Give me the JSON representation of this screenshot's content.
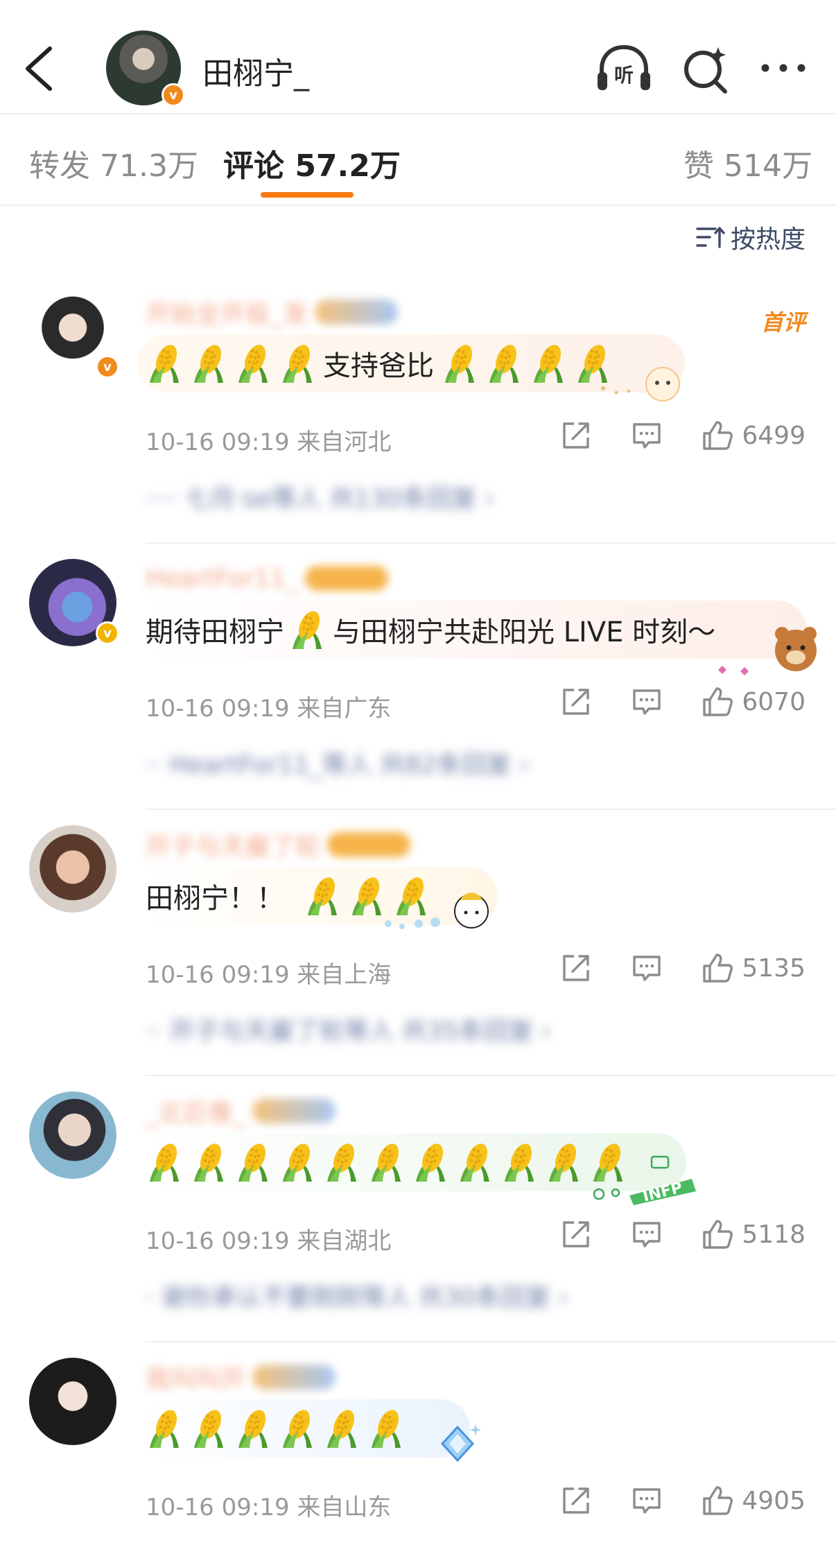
{
  "header": {
    "title": "田栩宁_",
    "listen_label": "听"
  },
  "tabs": {
    "repost": "转发 71.3万",
    "comment": "评论 57.2万",
    "like": "赞 514万"
  },
  "sort": {
    "label": "按热度"
  },
  "colors": {
    "accent": "#f77b12",
    "verified": "#f08a1c",
    "link": "#3d4a66"
  },
  "comments": [
    {
      "name": "开始全开投_发",
      "first_badge": "首评",
      "text": "支持爸比",
      "time": "10-16 09:19",
      "location": "来自河北",
      "likes": "6499",
      "reply_summary": "····  七月·se等人 共130条回复 ›"
    },
    {
      "name": "HeartFor11_",
      "text": "期待田栩宁",
      "text_after": "与田栩宁共赴阳光 LIVE 时刻～",
      "time": "10-16 09:19",
      "location": "来自广东",
      "likes": "6070",
      "reply_summary": "··  HeartFor11_等人 共82条回复 ›"
    },
    {
      "name": "开子与天雇了轮",
      "text": "田栩宁！！",
      "time": "10-16 09:19",
      "location": "来自上海",
      "likes": "5135",
      "reply_summary": "··  开子与天雇了轮等人 共35条回复 ›"
    },
    {
      "name": "_北巨像_",
      "text": "",
      "time": "10-16 09:19",
      "location": "来自湖北",
      "likes": "5118",
      "reply_summary": "·  谢你承认不要刚刚等人 共30条回复 ›"
    },
    {
      "name": "我叫叫开",
      "text": "",
      "time": "10-16 09:19",
      "location": "来自山东",
      "likes": "4905",
      "reply_summary": ""
    }
  ]
}
